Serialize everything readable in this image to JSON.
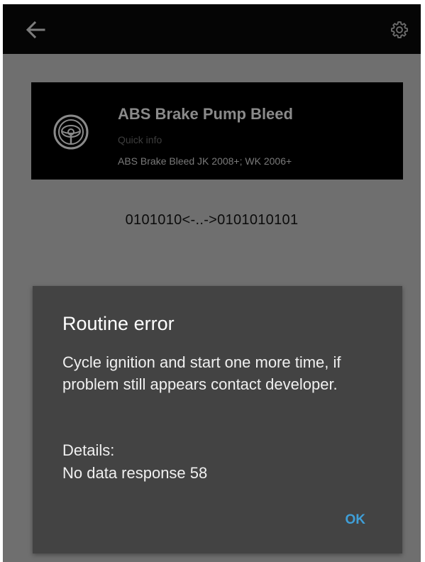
{
  "toolbar": {
    "back_icon": "arrow-left-icon",
    "settings_icon": "gear-icon"
  },
  "routine_card": {
    "icon": "steering-wheel-icon",
    "title": "ABS Brake Pump Bleed",
    "subtitle": "Quick info",
    "description": "ABS Brake Bleed JK 2008+; WK 2006+"
  },
  "data_stream": "0101010<-..->0101010101",
  "dialog": {
    "title": "Routine error",
    "message": "Cycle ignition and start one more time, if problem still appears contact developer.",
    "details_label": "Details:",
    "details_value": "No data response 58",
    "ok_label": "OK"
  },
  "colors": {
    "toolbar_bg": "#050505",
    "screen_bg": "#6f6f6f",
    "dialog_bg": "#434343",
    "accent": "#3f9fd8"
  }
}
